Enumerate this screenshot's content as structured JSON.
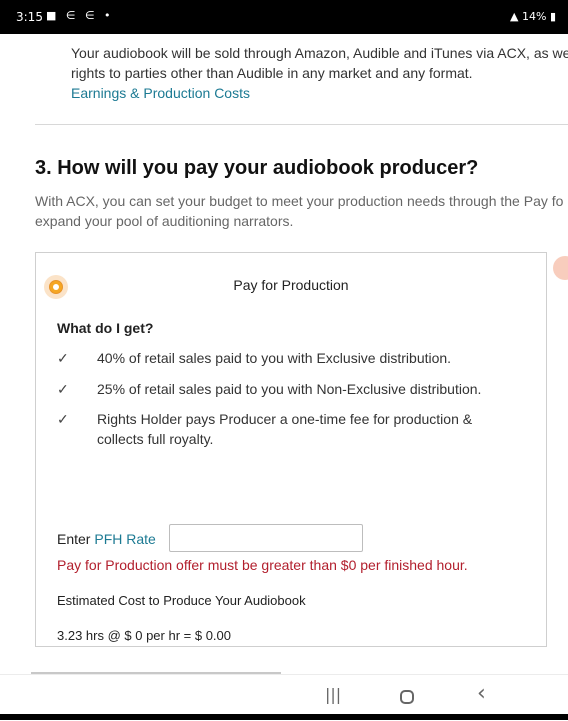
{
  "status_bar": {
    "time": "3:15",
    "left_icons": "■ ∈ ∈ •",
    "battery": "14%"
  },
  "intro": {
    "line1": "Your audiobook will be sold through Amazon, Audible and iTunes via ACX, as we",
    "line2": "rights to parties other than Audible in any market and any format.",
    "link": "Earnings & Production Costs"
  },
  "section": {
    "heading": "3. How will you pay your audiobook producer?",
    "desc_line1": "With ACX, you can set your budget to meet your production needs through the Pay fo",
    "desc_line2": "expand your pool of auditioning narrators."
  },
  "card": {
    "title": "Pay for Production",
    "subtitle": "What do I get?",
    "benefits": [
      "40% of retail sales paid to you with Exclusive distribution.",
      "25% of retail sales paid to you with Non-Exclusive distribution.",
      "Rights Holder pays Producer a one-time fee for production &",
      "collects full royalty."
    ],
    "check_glyph": "✓",
    "pfh_label_prefix": "Enter ",
    "pfh_label_link": "PFH Rate",
    "pfh_value": "",
    "error": "Pay for Production offer must be greater than $0 per finished hour.",
    "estimate_label": "Estimated Cost to Produce Your Audiobook",
    "estimate_calc": "3.23 hrs @ $ 0 per hr = $ 0.00"
  },
  "nav": {
    "recents": "|||",
    "back": "‹"
  },
  "colors": {
    "link": "#1c7a93",
    "error": "#b21f2d",
    "radio_selected": "#f5a623"
  }
}
